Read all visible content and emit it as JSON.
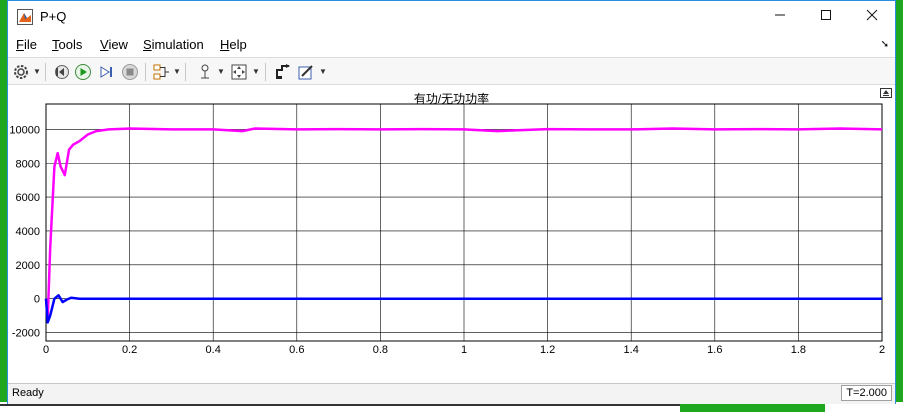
{
  "window": {
    "title": "P+Q"
  },
  "menu": [
    {
      "label": "File",
      "underline": "F",
      "rest": "ile"
    },
    {
      "label": "Tools",
      "underline": "T",
      "rest": "ools"
    },
    {
      "label": "View",
      "underline": "V",
      "rest": "iew"
    },
    {
      "label": "Simulation",
      "underline": "S",
      "rest": "imulation"
    },
    {
      "label": "Help",
      "underline": "H",
      "rest": "elp"
    }
  ],
  "toolbar": {
    "icons": [
      "gear-icon",
      "step-back-icon",
      "run-icon",
      "step-forward-icon",
      "stop-icon",
      "signal-select-icon",
      "cursor-icon",
      "zoom-fit-icon",
      "highlight-block-icon",
      "style-icon"
    ]
  },
  "status": {
    "text": "Ready",
    "time": "T=2.000"
  },
  "colors": {
    "series_p": "#ff00ff",
    "series_q": "#0000ff",
    "grid": "#000000",
    "titlebar_border": "#2b8ce0",
    "desktop": "#1fa81f"
  },
  "chart_data": {
    "type": "line",
    "title": "有功/无功功率",
    "xlabel": "",
    "ylabel": "",
    "xlim": [
      0,
      2
    ],
    "ylim": [
      -2500,
      11500
    ],
    "xticks": [
      "0",
      "0.2",
      "0.4",
      "0.6",
      "0.8",
      "1",
      "1.2",
      "1.4",
      "1.6",
      "1.8",
      "2"
    ],
    "xtick_values": [
      0,
      0.2,
      0.4,
      0.6,
      0.8,
      1.0,
      1.2,
      1.4,
      1.6,
      1.8,
      2.0
    ],
    "yticks": [
      "-2000",
      "0",
      "2000",
      "4000",
      "6000",
      "8000",
      "10000"
    ],
    "ytick_values": [
      -2000,
      0,
      2000,
      4000,
      6000,
      8000,
      10000
    ],
    "grid": true,
    "series": [
      {
        "color": "#ff00ff",
        "x": [
          0,
          0.004,
          0.01,
          0.02,
          0.028,
          0.035,
          0.045,
          0.055,
          0.065,
          0.08,
          0.1,
          0.12,
          0.15,
          0.2,
          0.3,
          0.4,
          0.47,
          0.5,
          0.6,
          0.7,
          0.8,
          0.9,
          1.0,
          1.08,
          1.2,
          1.3,
          1.4,
          1.5,
          1.6,
          1.7,
          1.8,
          1.9,
          2.0
        ],
        "y": [
          0,
          -1200,
          3000,
          7800,
          8600,
          7800,
          7300,
          8800,
          9100,
          9300,
          9700,
          9900,
          10000,
          10050,
          10000,
          10000,
          9900,
          10050,
          10000,
          10020,
          10000,
          10020,
          10000,
          9900,
          10020,
          10000,
          10000,
          10050,
          10000,
          10020,
          10000,
          10050,
          10000
        ]
      },
      {
        "color": "#0000ff",
        "x": [
          0,
          0.004,
          0.01,
          0.02,
          0.03,
          0.04,
          0.05,
          0.06,
          0.08,
          0.1,
          0.2,
          0.4,
          0.6,
          0.8,
          1.0,
          1.2,
          1.4,
          1.6,
          1.8,
          2.0
        ],
        "y": [
          0,
          -1400,
          -1000,
          0,
          200,
          -200,
          -50,
          50,
          0,
          0,
          0,
          0,
          0,
          0,
          0,
          0,
          0,
          0,
          0,
          0
        ]
      }
    ]
  }
}
